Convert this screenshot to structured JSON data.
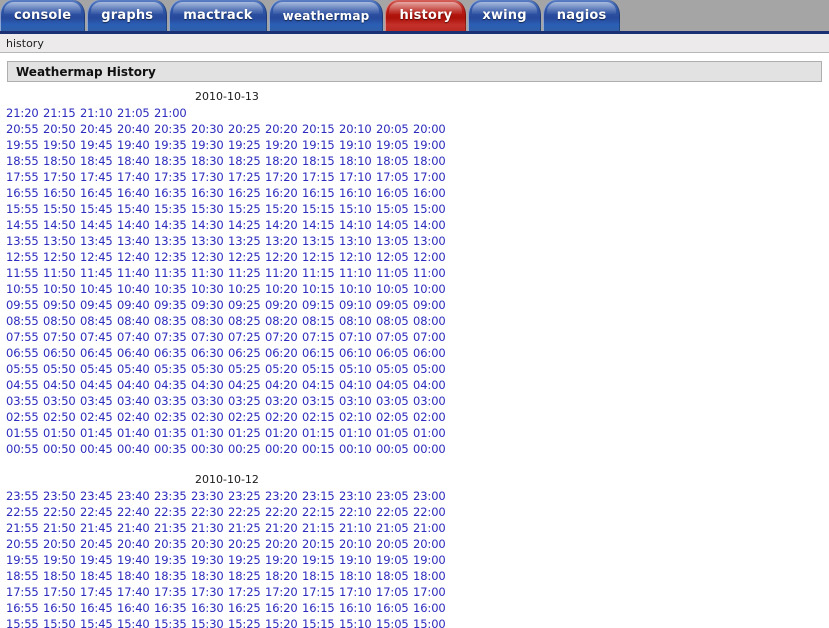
{
  "nav": {
    "tabs": [
      {
        "label": "console",
        "color": "blue",
        "active": false
      },
      {
        "label": "graphs",
        "color": "blue",
        "active": false
      },
      {
        "label": "mactrack",
        "color": "blue",
        "active": false
      },
      {
        "label": "weathermap",
        "color": "blue",
        "active": false,
        "small": true
      },
      {
        "label": "history",
        "color": "red",
        "active": true
      },
      {
        "label": "xwing",
        "color": "blue",
        "active": false
      },
      {
        "label": "nagios",
        "color": "blue",
        "active": false
      }
    ]
  },
  "breadcrumb": {
    "text": "history"
  },
  "panel": {
    "title": "Weathermap History"
  },
  "colors": {
    "tab_blue": "#2f55a6",
    "tab_red": "#b81d15",
    "nav_background": "#a5a5a5",
    "nav_underline": "#1b2f73",
    "link_blue": "#2b2bbd",
    "panel_header_bg": "#e2e2e2",
    "breadcrumb_bg": "#eceaea"
  },
  "days": [
    {
      "date": "2010-10-13",
      "rows": [
        [
          "21:20",
          "21:15",
          "21:10",
          "21:05",
          "21:00"
        ],
        [
          "20:55",
          "20:50",
          "20:45",
          "20:40",
          "20:35",
          "20:30",
          "20:25",
          "20:20",
          "20:15",
          "20:10",
          "20:05",
          "20:00"
        ],
        [
          "19:55",
          "19:50",
          "19:45",
          "19:40",
          "19:35",
          "19:30",
          "19:25",
          "19:20",
          "19:15",
          "19:10",
          "19:05",
          "19:00"
        ],
        [
          "18:55",
          "18:50",
          "18:45",
          "18:40",
          "18:35",
          "18:30",
          "18:25",
          "18:20",
          "18:15",
          "18:10",
          "18:05",
          "18:00"
        ],
        [
          "17:55",
          "17:50",
          "17:45",
          "17:40",
          "17:35",
          "17:30",
          "17:25",
          "17:20",
          "17:15",
          "17:10",
          "17:05",
          "17:00"
        ],
        [
          "16:55",
          "16:50",
          "16:45",
          "16:40",
          "16:35",
          "16:30",
          "16:25",
          "16:20",
          "16:15",
          "16:10",
          "16:05",
          "16:00"
        ],
        [
          "15:55",
          "15:50",
          "15:45",
          "15:40",
          "15:35",
          "15:30",
          "15:25",
          "15:20",
          "15:15",
          "15:10",
          "15:05",
          "15:00"
        ],
        [
          "14:55",
          "14:50",
          "14:45",
          "14:40",
          "14:35",
          "14:30",
          "14:25",
          "14:20",
          "14:15",
          "14:10",
          "14:05",
          "14:00"
        ],
        [
          "13:55",
          "13:50",
          "13:45",
          "13:40",
          "13:35",
          "13:30",
          "13:25",
          "13:20",
          "13:15",
          "13:10",
          "13:05",
          "13:00"
        ],
        [
          "12:55",
          "12:50",
          "12:45",
          "12:40",
          "12:35",
          "12:30",
          "12:25",
          "12:20",
          "12:15",
          "12:10",
          "12:05",
          "12:00"
        ],
        [
          "11:55",
          "11:50",
          "11:45",
          "11:40",
          "11:35",
          "11:30",
          "11:25",
          "11:20",
          "11:15",
          "11:10",
          "11:05",
          "11:00"
        ],
        [
          "10:55",
          "10:50",
          "10:45",
          "10:40",
          "10:35",
          "10:30",
          "10:25",
          "10:20",
          "10:15",
          "10:10",
          "10:05",
          "10:00"
        ],
        [
          "09:55",
          "09:50",
          "09:45",
          "09:40",
          "09:35",
          "09:30",
          "09:25",
          "09:20",
          "09:15",
          "09:10",
          "09:05",
          "09:00"
        ],
        [
          "08:55",
          "08:50",
          "08:45",
          "08:40",
          "08:35",
          "08:30",
          "08:25",
          "08:20",
          "08:15",
          "08:10",
          "08:05",
          "08:00"
        ],
        [
          "07:55",
          "07:50",
          "07:45",
          "07:40",
          "07:35",
          "07:30",
          "07:25",
          "07:20",
          "07:15",
          "07:10",
          "07:05",
          "07:00"
        ],
        [
          "06:55",
          "06:50",
          "06:45",
          "06:40",
          "06:35",
          "06:30",
          "06:25",
          "06:20",
          "06:15",
          "06:10",
          "06:05",
          "06:00"
        ],
        [
          "05:55",
          "05:50",
          "05:45",
          "05:40",
          "05:35",
          "05:30",
          "05:25",
          "05:20",
          "05:15",
          "05:10",
          "05:05",
          "05:00"
        ],
        [
          "04:55",
          "04:50",
          "04:45",
          "04:40",
          "04:35",
          "04:30",
          "04:25",
          "04:20",
          "04:15",
          "04:10",
          "04:05",
          "04:00"
        ],
        [
          "03:55",
          "03:50",
          "03:45",
          "03:40",
          "03:35",
          "03:30",
          "03:25",
          "03:20",
          "03:15",
          "03:10",
          "03:05",
          "03:00"
        ],
        [
          "02:55",
          "02:50",
          "02:45",
          "02:40",
          "02:35",
          "02:30",
          "02:25",
          "02:20",
          "02:15",
          "02:10",
          "02:05",
          "02:00"
        ],
        [
          "01:55",
          "01:50",
          "01:45",
          "01:40",
          "01:35",
          "01:30",
          "01:25",
          "01:20",
          "01:15",
          "01:10",
          "01:05",
          "01:00"
        ],
        [
          "00:55",
          "00:50",
          "00:45",
          "00:40",
          "00:35",
          "00:30",
          "00:25",
          "00:20",
          "00:15",
          "00:10",
          "00:05",
          "00:00"
        ]
      ]
    },
    {
      "date": "2010-10-12",
      "rows": [
        [
          "23:55",
          "23:50",
          "23:45",
          "23:40",
          "23:35",
          "23:30",
          "23:25",
          "23:20",
          "23:15",
          "23:10",
          "23:05",
          "23:00"
        ],
        [
          "22:55",
          "22:50",
          "22:45",
          "22:40",
          "22:35",
          "22:30",
          "22:25",
          "22:20",
          "22:15",
          "22:10",
          "22:05",
          "22:00"
        ],
        [
          "21:55",
          "21:50",
          "21:45",
          "21:40",
          "21:35",
          "21:30",
          "21:25",
          "21:20",
          "21:15",
          "21:10",
          "21:05",
          "21:00"
        ],
        [
          "20:55",
          "20:50",
          "20:45",
          "20:40",
          "20:35",
          "20:30",
          "20:25",
          "20:20",
          "20:15",
          "20:10",
          "20:05",
          "20:00"
        ],
        [
          "19:55",
          "19:50",
          "19:45",
          "19:40",
          "19:35",
          "19:30",
          "19:25",
          "19:20",
          "19:15",
          "19:10",
          "19:05",
          "19:00"
        ],
        [
          "18:55",
          "18:50",
          "18:45",
          "18:40",
          "18:35",
          "18:30",
          "18:25",
          "18:20",
          "18:15",
          "18:10",
          "18:05",
          "18:00"
        ],
        [
          "17:55",
          "17:50",
          "17:45",
          "17:40",
          "17:35",
          "17:30",
          "17:25",
          "17:20",
          "17:15",
          "17:10",
          "17:05",
          "17:00"
        ],
        [
          "16:55",
          "16:50",
          "16:45",
          "16:40",
          "16:35",
          "16:30",
          "16:25",
          "16:20",
          "16:15",
          "16:10",
          "16:05",
          "16:00"
        ],
        [
          "15:55",
          "15:50",
          "15:45",
          "15:40",
          "15:35",
          "15:30",
          "15:25",
          "15:20",
          "15:15",
          "15:10",
          "15:05",
          "15:00"
        ]
      ]
    }
  ]
}
